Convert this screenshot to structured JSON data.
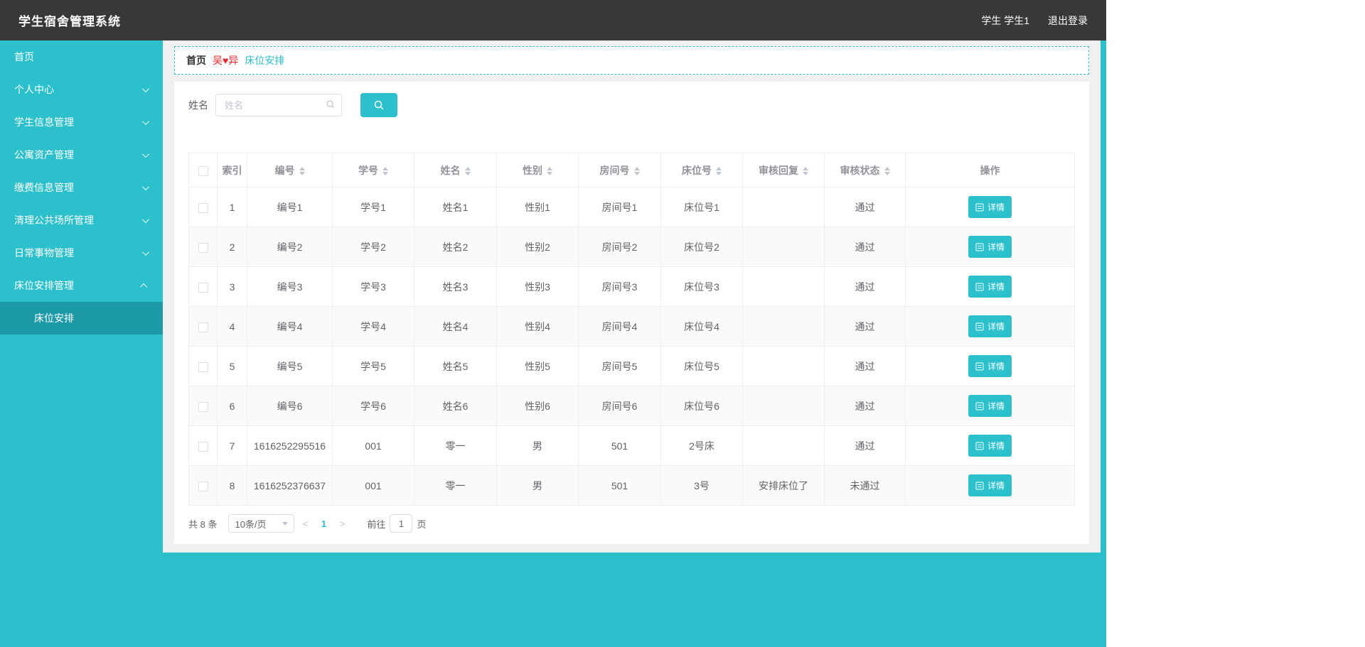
{
  "colors": {
    "accent": "#2bc0cb",
    "header_bg": "#383838",
    "sidebar_bg": "#2bc0cb",
    "sidebar_active_bg": "#1d9aa8",
    "sep_red": "#e8262d",
    "table_border": "#ebeef5",
    "stripe": "#fafafa",
    "text": "#606266",
    "muted": "#909399"
  },
  "header": {
    "title": "学生宿舍管理系统",
    "user": "学生 学生1",
    "logout": "退出登录"
  },
  "sidebar": {
    "items": [
      {
        "label": "首页",
        "chevron": "none"
      },
      {
        "label": "个人中心",
        "chevron": "down"
      },
      {
        "label": "学生信息管理",
        "chevron": "down"
      },
      {
        "label": "公寓资产管理",
        "chevron": "down"
      },
      {
        "label": "缴费信息管理",
        "chevron": "down"
      },
      {
        "label": "清理公共场所管理",
        "chevron": "down"
      },
      {
        "label": "日常事物管理",
        "chevron": "down"
      },
      {
        "label": "床位安排管理",
        "chevron": "up"
      }
    ],
    "submenu": {
      "label": "床位安排",
      "active": true
    }
  },
  "breadcrumb": {
    "home": "首页",
    "separator": "吴♥异",
    "current": "床位安排"
  },
  "search": {
    "label": "姓名",
    "placeholder": "姓名"
  },
  "table": {
    "columns": [
      {
        "label": "索引",
        "sortable": false
      },
      {
        "label": "编号",
        "sortable": true
      },
      {
        "label": "学号",
        "sortable": true
      },
      {
        "label": "姓名",
        "sortable": true
      },
      {
        "label": "性别",
        "sortable": true
      },
      {
        "label": "房间号",
        "sortable": true
      },
      {
        "label": "床位号",
        "sortable": true
      },
      {
        "label": "审核回复",
        "sortable": true
      },
      {
        "label": "审核状态",
        "sortable": true
      },
      {
        "label": "操作",
        "sortable": false
      }
    ],
    "action_label": "详情",
    "rows": [
      {
        "idx": "1",
        "no": "编号1",
        "sid": "学号1",
        "name": "姓名1",
        "gender": "性别1",
        "room": "房间号1",
        "bed": "床位号1",
        "reply": "",
        "status": "通过"
      },
      {
        "idx": "2",
        "no": "编号2",
        "sid": "学号2",
        "name": "姓名2",
        "gender": "性别2",
        "room": "房间号2",
        "bed": "床位号2",
        "reply": "",
        "status": "通过"
      },
      {
        "idx": "3",
        "no": "编号3",
        "sid": "学号3",
        "name": "姓名3",
        "gender": "性别3",
        "room": "房间号3",
        "bed": "床位号3",
        "reply": "",
        "status": "通过"
      },
      {
        "idx": "4",
        "no": "编号4",
        "sid": "学号4",
        "name": "姓名4",
        "gender": "性别4",
        "room": "房间号4",
        "bed": "床位号4",
        "reply": "",
        "status": "通过"
      },
      {
        "idx": "5",
        "no": "编号5",
        "sid": "学号5",
        "name": "姓名5",
        "gender": "性别5",
        "room": "房间号5",
        "bed": "床位号5",
        "reply": "",
        "status": "通过"
      },
      {
        "idx": "6",
        "no": "编号6",
        "sid": "学号6",
        "name": "姓名6",
        "gender": "性别6",
        "room": "房间号6",
        "bed": "床位号6",
        "reply": "",
        "status": "通过"
      },
      {
        "idx": "7",
        "no": "1616252295516",
        "sid": "001",
        "name": "零一",
        "gender": "男",
        "room": "501",
        "bed": "2号床",
        "reply": "",
        "status": "通过"
      },
      {
        "idx": "8",
        "no": "1616252376637",
        "sid": "001",
        "name": "零一",
        "gender": "男",
        "room": "501",
        "bed": "3号",
        "reply": "安排床位了",
        "status": "未通过"
      }
    ]
  },
  "pagination": {
    "total": "共 8 条",
    "page_size": "10条/页",
    "prev": "<",
    "next": ">",
    "current_page": "1",
    "goto_prefix": "前往",
    "goto_value": "1",
    "goto_suffix": "页"
  },
  "icons": {
    "search_input": "magnifier-icon",
    "search_button": "magnifier-icon",
    "detail_button": "detail-document-icon",
    "menu_collapsed": "chevron-down-icon",
    "menu_expanded": "chevron-up-icon",
    "page_size": "caret-down-icon"
  }
}
